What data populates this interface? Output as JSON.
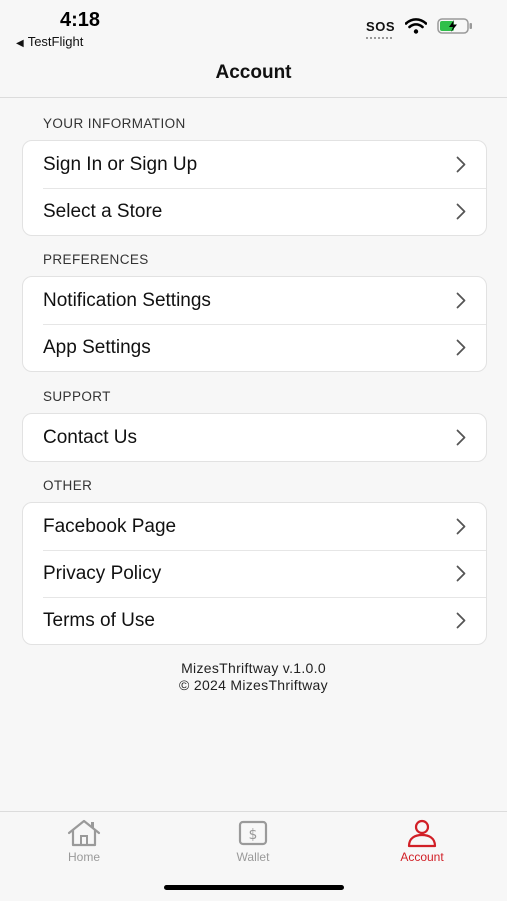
{
  "status_bar": {
    "time": "4:18",
    "back_app": "TestFlight",
    "carrier": "SOS"
  },
  "nav": {
    "title": "Account"
  },
  "sections": [
    {
      "header": "YOUR INFORMATION",
      "items": [
        {
          "label": "Sign In or Sign Up"
        },
        {
          "label": "Select a Store"
        }
      ]
    },
    {
      "header": "PREFERENCES",
      "items": [
        {
          "label": "Notification Settings"
        },
        {
          "label": "App Settings"
        }
      ]
    },
    {
      "header": "SUPPORT",
      "items": [
        {
          "label": "Contact Us"
        }
      ]
    },
    {
      "header": "OTHER",
      "items": [
        {
          "label": "Facebook Page"
        },
        {
          "label": "Privacy Policy"
        },
        {
          "label": "Terms of Use"
        }
      ]
    }
  ],
  "footer": {
    "version": "MizesThriftway v.1.0.0",
    "copyright": "© 2024 MizesThriftway"
  },
  "tabs": [
    {
      "label": "Home",
      "icon": "home-icon",
      "active": false
    },
    {
      "label": "Wallet",
      "icon": "wallet-icon",
      "active": false
    },
    {
      "label": "Account",
      "icon": "person-icon",
      "active": true
    }
  ],
  "colors": {
    "accent": "#d11f26",
    "inactive_tab": "#9a9a9a",
    "background": "#f7f7f7"
  }
}
